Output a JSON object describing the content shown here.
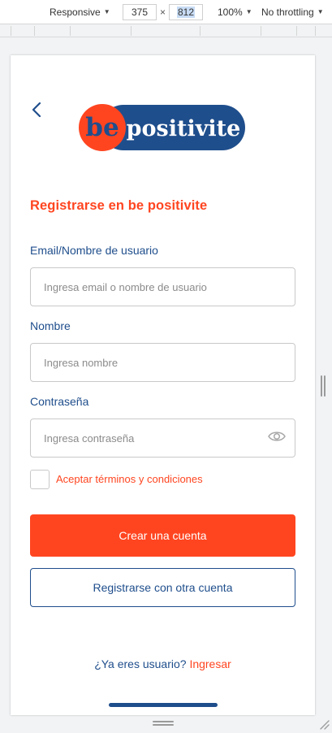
{
  "devtools": {
    "device": "Responsive",
    "width": "375",
    "height": "812",
    "zoom": "100%",
    "throttling": "No throttling"
  },
  "logo": {
    "part1": "be",
    "part2": "positivite",
    "colors": {
      "orange": "#ff4520",
      "navy": "#1f4e8c"
    }
  },
  "page": {
    "title": "Registrarse en be positivite"
  },
  "form": {
    "email": {
      "label": "Email/Nombre de usuario",
      "value": "",
      "placeholder": "Ingresa email o nombre de usuario"
    },
    "name": {
      "label": "Nombre",
      "value": "",
      "placeholder": "Ingresa nombre"
    },
    "password": {
      "label": "Contraseña",
      "value": "",
      "placeholder": "Ingresa contraseña",
      "toggle_icon": "eye-icon"
    },
    "terms_label": "Aceptar términos y condiciones",
    "terms_checked": false
  },
  "buttons": {
    "create_account": "Crear una cuenta",
    "other_account": "Registrarse con otra cuenta"
  },
  "footer": {
    "question": "¿Ya eres usuario?",
    "login_link": "Ingresar"
  },
  "theme": {
    "accent": "#ff4520",
    "primary": "#1f4e8c",
    "border": "#c9c9c9"
  }
}
